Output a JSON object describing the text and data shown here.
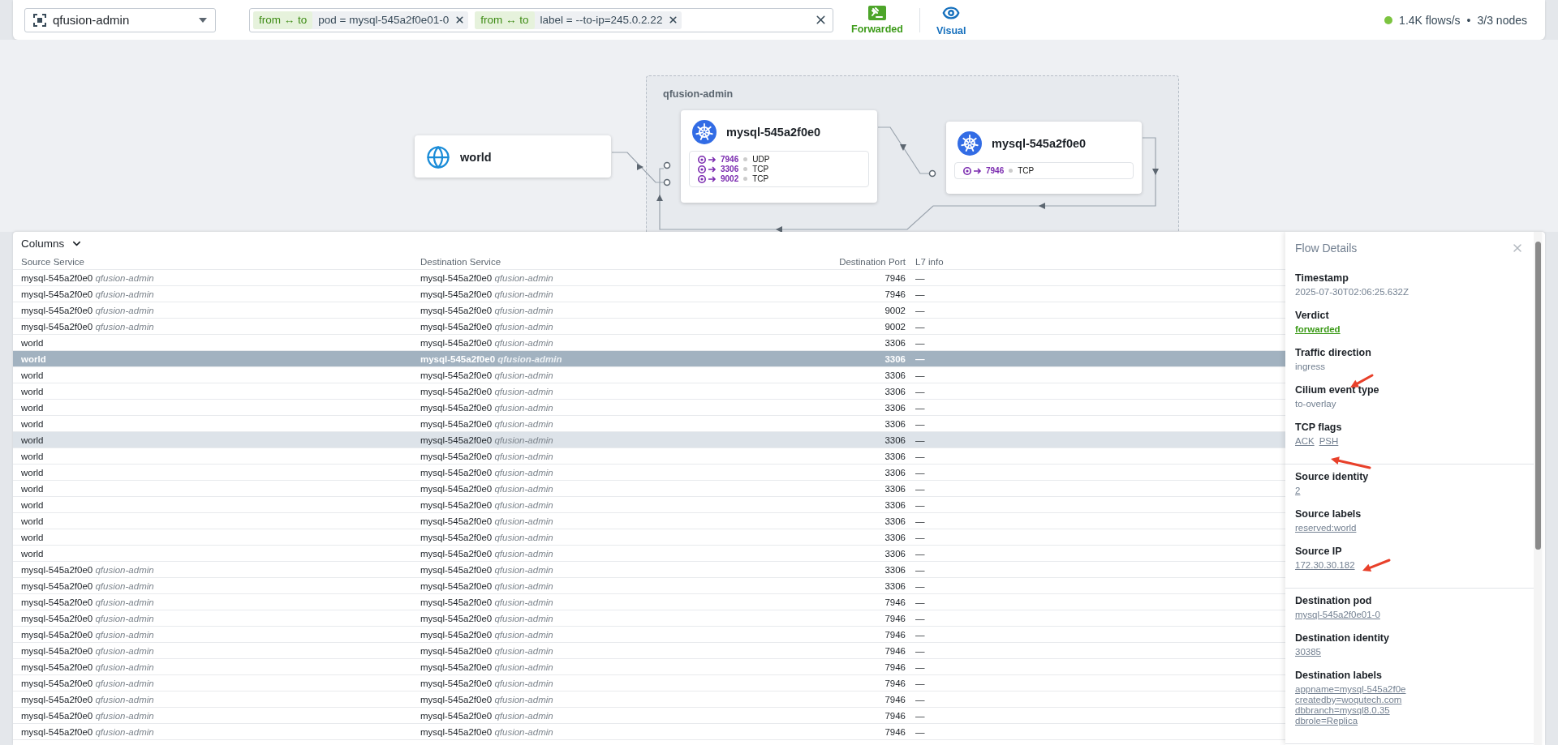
{
  "namespace_selector": {
    "value": "qfusion-admin"
  },
  "filters": [
    {
      "direction": "from ↔ to",
      "label": "pod = mysql-545a2f0e01-0"
    },
    {
      "direction": "from ↔ to",
      "label": "label = --to-ip=245.0.2.22"
    }
  ],
  "toolbar": [
    {
      "kind": "verdict",
      "label": "Forwarded"
    },
    {
      "kind": "visual",
      "label": "Visual"
    }
  ],
  "status": {
    "flows": "1.4K flows/s",
    "separator": "•",
    "nodes": "3/3 nodes"
  },
  "graph": {
    "namespace": "qfusion-admin",
    "nodes": [
      {
        "kind": "world",
        "name": "world"
      },
      {
        "kind": "pod",
        "name": "mysql-545a2f0e0",
        "ports": [
          {
            "port": "7946",
            "protocol": "UDP"
          },
          {
            "port": "3306",
            "protocol": "TCP"
          },
          {
            "port": "9002",
            "protocol": "TCP"
          }
        ]
      },
      {
        "kind": "pod",
        "name": "mysql-545a2f0e0",
        "ports": [
          {
            "port": "7946",
            "protocol": "TCP"
          }
        ]
      }
    ]
  },
  "table": {
    "columns_button": "Columns",
    "columns": [
      "Source Service",
      "Destination Service",
      "Destination Port",
      "L7 info"
    ],
    "rows": [
      {
        "source": "mysql-545a2f0e0",
        "source_namespace": "qfusion-admin",
        "destination": "mysql-545a2f0e0",
        "destination_namespace": "qfusion-admin",
        "port": "7946",
        "l7": "—",
        "selected": false,
        "hovered": false
      },
      {
        "source": "mysql-545a2f0e0",
        "source_namespace": "qfusion-admin",
        "destination": "mysql-545a2f0e0",
        "destination_namespace": "qfusion-admin",
        "port": "7946",
        "l7": "—",
        "selected": false,
        "hovered": false
      },
      {
        "source": "mysql-545a2f0e0",
        "source_namespace": "qfusion-admin",
        "destination": "mysql-545a2f0e0",
        "destination_namespace": "qfusion-admin",
        "port": "9002",
        "l7": "—",
        "selected": false,
        "hovered": false
      },
      {
        "source": "mysql-545a2f0e0",
        "source_namespace": "qfusion-admin",
        "destination": "mysql-545a2f0e0",
        "destination_namespace": "qfusion-admin",
        "port": "9002",
        "l7": "—",
        "selected": false,
        "hovered": false
      },
      {
        "source": "world",
        "destination": "mysql-545a2f0e0",
        "destination_namespace": "qfusion-admin",
        "port": "3306",
        "l7": "—",
        "selected": false,
        "hovered": false
      },
      {
        "source": "world",
        "destination": "mysql-545a2f0e0",
        "destination_namespace": "qfusion-admin",
        "port": "3306",
        "l7": "—",
        "selected": true,
        "hovered": false
      },
      {
        "source": "world",
        "destination": "mysql-545a2f0e0",
        "destination_namespace": "qfusion-admin",
        "port": "3306",
        "l7": "—",
        "selected": false,
        "hovered": false
      },
      {
        "source": "world",
        "destination": "mysql-545a2f0e0",
        "destination_namespace": "qfusion-admin",
        "port": "3306",
        "l7": "—",
        "selected": false,
        "hovered": false
      },
      {
        "source": "world",
        "destination": "mysql-545a2f0e0",
        "destination_namespace": "qfusion-admin",
        "port": "3306",
        "l7": "—",
        "selected": false,
        "hovered": false
      },
      {
        "source": "world",
        "destination": "mysql-545a2f0e0",
        "destination_namespace": "qfusion-admin",
        "port": "3306",
        "l7": "—",
        "selected": false,
        "hovered": false
      },
      {
        "source": "world",
        "destination": "mysql-545a2f0e0",
        "destination_namespace": "qfusion-admin",
        "port": "3306",
        "l7": "—",
        "selected": false,
        "hovered": true
      },
      {
        "source": "world",
        "destination": "mysql-545a2f0e0",
        "destination_namespace": "qfusion-admin",
        "port": "3306",
        "l7": "—",
        "selected": false,
        "hovered": false
      },
      {
        "source": "world",
        "destination": "mysql-545a2f0e0",
        "destination_namespace": "qfusion-admin",
        "port": "3306",
        "l7": "—",
        "selected": false,
        "hovered": false
      },
      {
        "source": "world",
        "destination": "mysql-545a2f0e0",
        "destination_namespace": "qfusion-admin",
        "port": "3306",
        "l7": "—",
        "selected": false,
        "hovered": false
      },
      {
        "source": "world",
        "destination": "mysql-545a2f0e0",
        "destination_namespace": "qfusion-admin",
        "port": "3306",
        "l7": "—",
        "selected": false,
        "hovered": false
      },
      {
        "source": "world",
        "destination": "mysql-545a2f0e0",
        "destination_namespace": "qfusion-admin",
        "port": "3306",
        "l7": "—",
        "selected": false,
        "hovered": false
      },
      {
        "source": "world",
        "destination": "mysql-545a2f0e0",
        "destination_namespace": "qfusion-admin",
        "port": "3306",
        "l7": "—",
        "selected": false,
        "hovered": false
      },
      {
        "source": "world",
        "destination": "mysql-545a2f0e0",
        "destination_namespace": "qfusion-admin",
        "port": "3306",
        "l7": "—",
        "selected": false,
        "hovered": false
      },
      {
        "source": "mysql-545a2f0e0",
        "source_namespace": "qfusion-admin",
        "destination": "mysql-545a2f0e0",
        "destination_namespace": "qfusion-admin",
        "port": "3306",
        "l7": "—",
        "selected": false,
        "hovered": false
      },
      {
        "source": "mysql-545a2f0e0",
        "source_namespace": "qfusion-admin",
        "destination": "mysql-545a2f0e0",
        "destination_namespace": "qfusion-admin",
        "port": "3306",
        "l7": "—",
        "selected": false,
        "hovered": false
      },
      {
        "source": "mysql-545a2f0e0",
        "source_namespace": "qfusion-admin",
        "destination": "mysql-545a2f0e0",
        "destination_namespace": "qfusion-admin",
        "port": "7946",
        "l7": "—",
        "selected": false,
        "hovered": false
      },
      {
        "source": "mysql-545a2f0e0",
        "source_namespace": "qfusion-admin",
        "destination": "mysql-545a2f0e0",
        "destination_namespace": "qfusion-admin",
        "port": "7946",
        "l7": "—",
        "selected": false,
        "hovered": false
      },
      {
        "source": "mysql-545a2f0e0",
        "source_namespace": "qfusion-admin",
        "destination": "mysql-545a2f0e0",
        "destination_namespace": "qfusion-admin",
        "port": "7946",
        "l7": "—",
        "selected": false,
        "hovered": false
      },
      {
        "source": "mysql-545a2f0e0",
        "source_namespace": "qfusion-admin",
        "destination": "mysql-545a2f0e0",
        "destination_namespace": "qfusion-admin",
        "port": "7946",
        "l7": "—",
        "selected": false,
        "hovered": false
      },
      {
        "source": "mysql-545a2f0e0",
        "source_namespace": "qfusion-admin",
        "destination": "mysql-545a2f0e0",
        "destination_namespace": "qfusion-admin",
        "port": "7946",
        "l7": "—",
        "selected": false,
        "hovered": false
      },
      {
        "source": "mysql-545a2f0e0",
        "source_namespace": "qfusion-admin",
        "destination": "mysql-545a2f0e0",
        "destination_namespace": "qfusion-admin",
        "port": "7946",
        "l7": "—",
        "selected": false,
        "hovered": false
      },
      {
        "source": "mysql-545a2f0e0",
        "source_namespace": "qfusion-admin",
        "destination": "mysql-545a2f0e0",
        "destination_namespace": "qfusion-admin",
        "port": "7946",
        "l7": "—",
        "selected": false,
        "hovered": false
      },
      {
        "source": "mysql-545a2f0e0",
        "source_namespace": "qfusion-admin",
        "destination": "mysql-545a2f0e0",
        "destination_namespace": "qfusion-admin",
        "port": "7946",
        "l7": "—",
        "selected": false,
        "hovered": false
      },
      {
        "source": "mysql-545a2f0e0",
        "source_namespace": "qfusion-admin",
        "destination": "mysql-545a2f0e0",
        "destination_namespace": "qfusion-admin",
        "port": "7946",
        "l7": "—",
        "selected": false,
        "hovered": false
      }
    ]
  },
  "flow_details": {
    "title": "Flow Details",
    "sections": [
      {
        "fields": [
          {
            "label": "Timestamp",
            "kind": "text",
            "values": [
              "2025-07-30T02:06:25.632Z"
            ]
          },
          {
            "label": "Verdict",
            "kind": "verdict",
            "values": [
              "forwarded"
            ]
          },
          {
            "label": "Traffic direction",
            "kind": "text",
            "values": [
              "ingress"
            ]
          },
          {
            "label": "Cilium event type",
            "kind": "text",
            "values": [
              "to-overlay"
            ]
          },
          {
            "label": "TCP flags",
            "kind": "link",
            "values": [
              "ACK",
              "PSH"
            ]
          }
        ]
      },
      {
        "fields": [
          {
            "label": "Source identity",
            "kind": "link",
            "values": [
              "2"
            ]
          },
          {
            "label": "Source labels",
            "kind": "link",
            "values": [
              "reserved:world"
            ]
          },
          {
            "label": "Source IP",
            "kind": "link",
            "values": [
              "172.30.30.182"
            ]
          }
        ]
      },
      {
        "fields": [
          {
            "label": "Destination pod",
            "kind": "link",
            "values": [
              "mysql-545a2f0e01-0"
            ]
          },
          {
            "label": "Destination identity",
            "kind": "link",
            "values": [
              "30385"
            ]
          },
          {
            "label": "Destination labels",
            "kind": "link",
            "values": [
              "appname=mysql-545a2f0e",
              "createdby=woqutech.com",
              "dbbranch=mysql8.0.35",
              "dbrole=Replica"
            ]
          }
        ]
      }
    ]
  }
}
